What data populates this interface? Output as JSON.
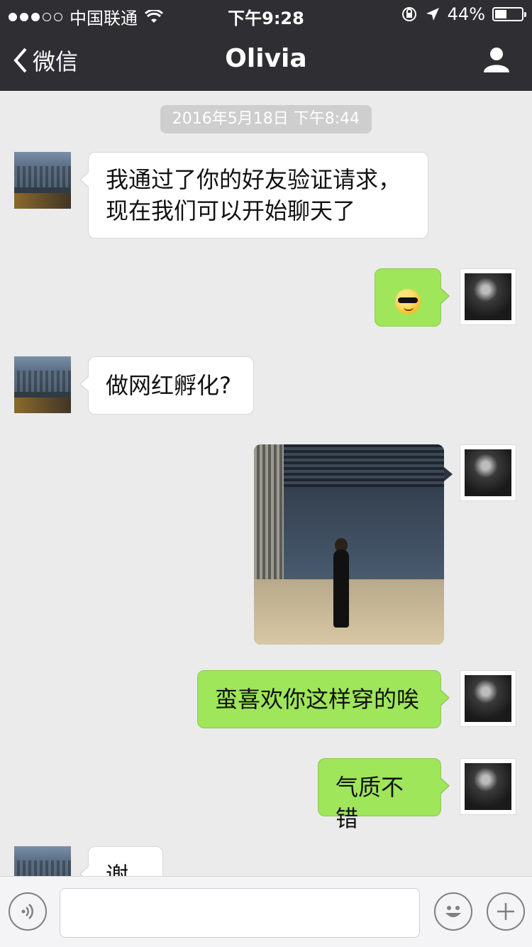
{
  "status_bar": {
    "carrier": "中国联通",
    "time": "下午9:28",
    "battery_percent": "44%",
    "battery_level": 0.44
  },
  "nav": {
    "back_label": "微信",
    "title": "Olivia"
  },
  "chat": {
    "timestamp": "2016年5月18日 下午8:44",
    "messages": [
      {
        "side": "left",
        "text": "我通过了你的好友验证请求，现在我们可以开始聊天了"
      },
      {
        "side": "right",
        "type": "emoji",
        "emoji": "cool-smirk-emoji"
      },
      {
        "side": "left",
        "text": "做网红孵化?"
      },
      {
        "side": "right",
        "type": "image"
      },
      {
        "side": "right",
        "text": "蛮喜欢你这样穿的唉"
      },
      {
        "side": "right",
        "text": "气质不错"
      },
      {
        "side": "left",
        "text": "谢谢"
      }
    ],
    "msg1_line1": "我通过了你的好友验证请求，",
    "msg1_line2": "现在我们可以开始聊天了"
  },
  "input": {
    "value": "",
    "placeholder": ""
  },
  "colors": {
    "bar": "#2f2f33",
    "bubble_right": "#9fe65a",
    "bubble_left": "#ffffff",
    "background": "#ebebeb"
  }
}
